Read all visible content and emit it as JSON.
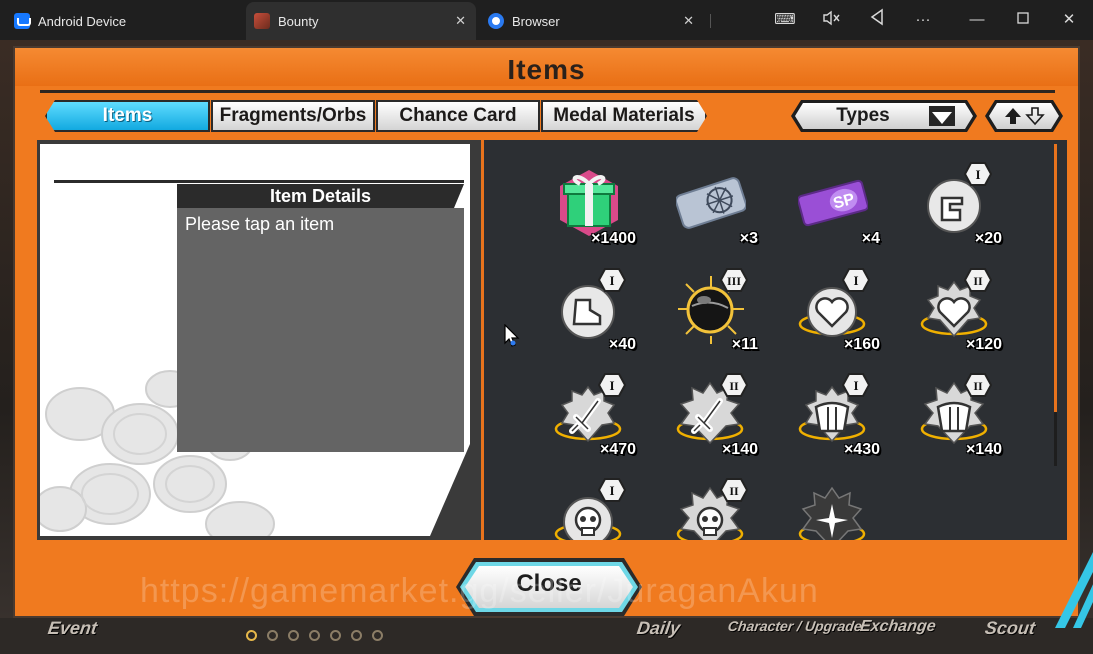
{
  "titlebar": {
    "tabs": [
      {
        "label": "Android Device"
      },
      {
        "label": "Bounty"
      },
      {
        "label": "Browser"
      }
    ]
  },
  "bottom_nav": {
    "labels": [
      "Event",
      "Daily",
      "Character / Upgrade",
      "Exchange",
      "Scout"
    ]
  },
  "modal": {
    "title": "Items",
    "tabs": [
      {
        "label": "Items",
        "active": true
      },
      {
        "label": "Fragments/Orbs"
      },
      {
        "label": "Chance Card"
      },
      {
        "label": "Medal Materials"
      }
    ],
    "types_label": "Types",
    "detail": {
      "header": "Item Details",
      "placeholder": "Please tap an item"
    },
    "items": [
      {
        "icon": "gift-box-icon",
        "count": "×1400"
      },
      {
        "icon": "compass-ticket-icon",
        "count": "×3"
      },
      {
        "icon": "sp-ticket-icon",
        "count": "×4"
      },
      {
        "icon": "fist-medal-icon",
        "rank": "I",
        "count": "×20"
      },
      {
        "icon": "boot-medal-icon",
        "rank": "I",
        "count": "×40"
      },
      {
        "icon": "black-orb-icon",
        "rank": "III",
        "count": "×11"
      },
      {
        "icon": "heart-medal-icon",
        "rank": "I",
        "count": "×160"
      },
      {
        "icon": "heart-medal-icon",
        "rank": "II",
        "count": "×120"
      },
      {
        "icon": "sword-medal-icon",
        "rank": "I",
        "count": "×470"
      },
      {
        "icon": "sword-medal-icon",
        "rank": "II",
        "count": "×140"
      },
      {
        "icon": "armor-medal-icon",
        "rank": "I",
        "count": "×430"
      },
      {
        "icon": "armor-medal-icon",
        "rank": "II",
        "count": "×140"
      },
      {
        "icon": "skull-medal-icon",
        "rank": "I",
        "count": ""
      },
      {
        "icon": "skull-medal-icon",
        "rank": "II",
        "count": ""
      },
      {
        "icon": "sparkle-medal-icon",
        "rank": "",
        "count": ""
      }
    ],
    "close_label": "Close"
  },
  "watermark": "https://gamemarket.gg/seller/JuraganAkun",
  "colors": {
    "modal_orange": "#f07a1f",
    "tab_active_blue": "#12a9e0",
    "panel_dark": "#2c2f33"
  }
}
